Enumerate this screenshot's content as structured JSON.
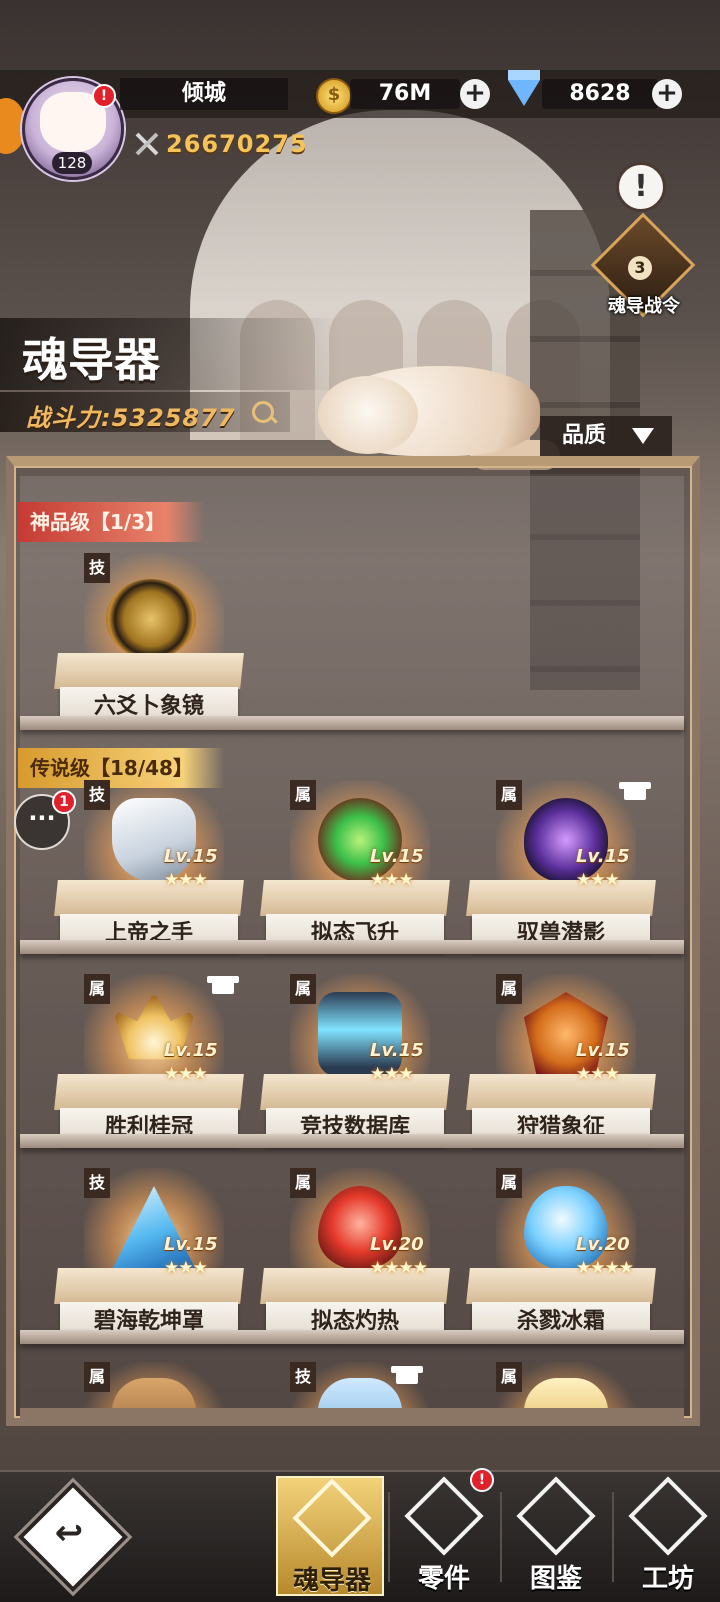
{
  "header": {
    "player_name": "倾城",
    "player_level": "128",
    "avatar_alert": "!",
    "combat_power": "26670275",
    "gold": "76M",
    "gems": "8628"
  },
  "right_widgets": {
    "info_symbol": "!",
    "pass_level": "3",
    "pass_label": "魂导战令"
  },
  "page": {
    "title": "魂导器",
    "power_label": "战斗力:5325877",
    "sort_label": "品质"
  },
  "sections": {
    "divine": {
      "label": "神品级【1/3】"
    },
    "legend": {
      "label": "传说级【18/48】"
    }
  },
  "items": {
    "divine": [
      {
        "tag": "技",
        "name": "六爻卜象镜",
        "icon": "mirror-icon"
      }
    ],
    "legend": [
      {
        "tag": "技",
        "name": "上帝之手",
        "level": "Lv.15",
        "stars": "★★★",
        "shirt": false,
        "icon": "mech-hand-icon"
      },
      {
        "tag": "属",
        "name": "拟态飞升",
        "level": "Lv.15",
        "stars": "★★★",
        "shirt": false,
        "icon": "ascend-swirl-icon"
      },
      {
        "tag": "属",
        "name": "驭兽潜影",
        "level": "Lv.15",
        "stars": "★★★",
        "shirt": true,
        "icon": "beast-shadow-icon"
      },
      {
        "tag": "属",
        "name": "胜利桂冠",
        "level": "Lv.15",
        "stars": "★★★",
        "shirt": true,
        "icon": "laurel-crown-icon"
      },
      {
        "tag": "属",
        "name": "竞技数据库",
        "level": "Lv.15",
        "stars": "★★★",
        "shirt": false,
        "icon": "data-core-icon"
      },
      {
        "tag": "属",
        "name": "狩猎象征",
        "level": "Lv.15",
        "stars": "★★★",
        "shirt": false,
        "icon": "hunt-mask-icon"
      },
      {
        "tag": "技",
        "name": "碧海乾坤罩",
        "level": "Lv.15",
        "stars": "★★★",
        "shirt": false,
        "icon": "crystal-pyramid-icon"
      },
      {
        "tag": "属",
        "name": "拟态灼热",
        "level": "Lv.20",
        "stars": "★★★★",
        "shirt": false,
        "icon": "flame-gem-icon"
      },
      {
        "tag": "属",
        "name": "杀戮冰霜",
        "level": "Lv.20",
        "stars": "★★★★",
        "shirt": false,
        "icon": "frost-drop-icon"
      }
    ],
    "peek": [
      {
        "tag": "属",
        "shirt": false
      },
      {
        "tag": "技",
        "shirt": true
      },
      {
        "tag": "属",
        "shirt": false
      }
    ]
  },
  "chat": {
    "badge": "1"
  },
  "bottom_nav": {
    "back_symbol": "↩",
    "tabs": [
      {
        "label": "魂导器",
        "active": true
      },
      {
        "label": "零件",
        "alert": "!"
      },
      {
        "label": "图鉴"
      },
      {
        "label": "工坊"
      }
    ]
  },
  "colors": {
    "divine_banner": "#c53a33",
    "legend_banner": "#d89a2c",
    "power_gold": "#f6c35a",
    "alert_red": "#e0202a"
  }
}
